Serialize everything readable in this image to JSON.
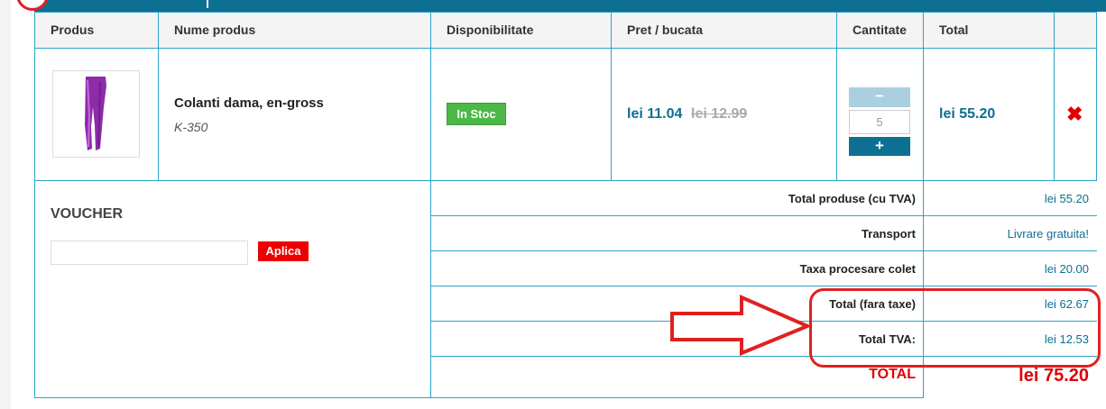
{
  "table": {
    "headers": [
      "Produs",
      "Nume produs",
      "Disponibilitate",
      "Pret / bucata",
      "Cantitate",
      "Total"
    ]
  },
  "item": {
    "name": "Colanti dama, en-gross",
    "code": "K-350",
    "availability": "In Stoc",
    "price": "lei 11.04",
    "old_price": "lei 12.99",
    "quantity": "5",
    "minus_label": "−",
    "plus_label": "+",
    "total": "lei 55.20",
    "remove_icon": "remove-x-icon"
  },
  "voucher": {
    "title": "VOUCHER",
    "input_value": "",
    "apply_label": "Aplica"
  },
  "summary": [
    {
      "label": "Total produse (cu TVA)",
      "value": "lei 55.20"
    },
    {
      "label": "Transport",
      "value": "Livrare gratuita!"
    },
    {
      "label": "Taxa procesare colet",
      "value": "lei 20.00"
    },
    {
      "label": "Total (fara taxe)",
      "value": "lei 62.67"
    },
    {
      "label": "Total TVA:",
      "value": "lei 12.53"
    }
  ],
  "grand_total": {
    "label": "TOTAL",
    "value": "lei 75.20"
  },
  "colors": {
    "accent": "#0d6f92",
    "stock": "#4cb847",
    "danger": "#e00000",
    "border": "#2ba5c7"
  }
}
